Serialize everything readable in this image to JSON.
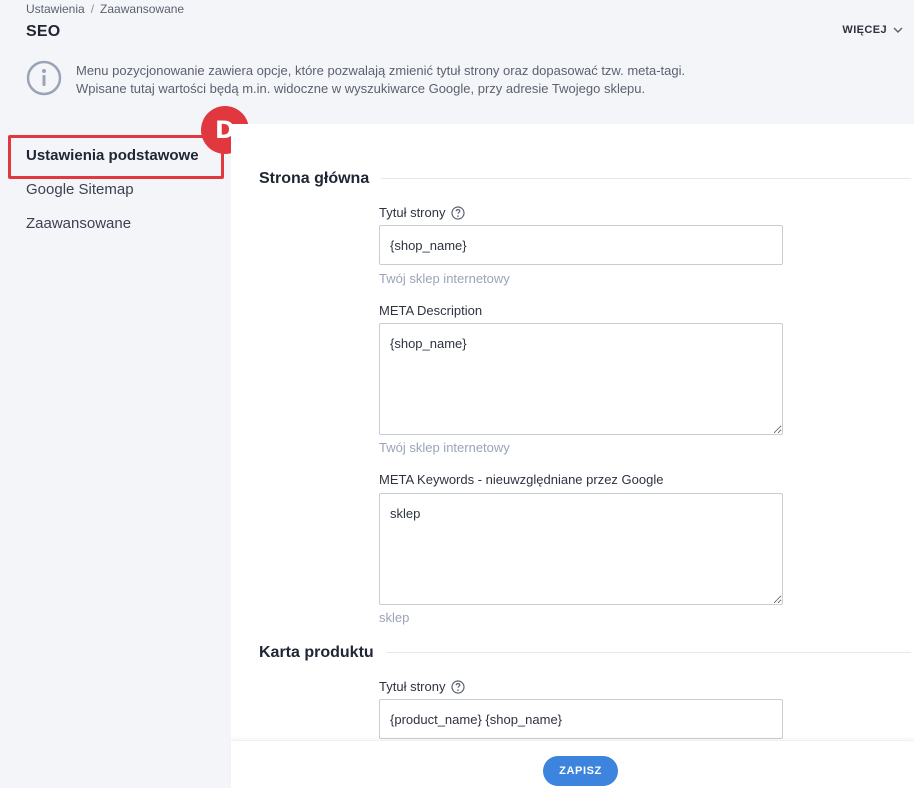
{
  "breadcrumb": {
    "items": [
      "Ustawienia",
      "Zaawansowane"
    ],
    "separator": "/"
  },
  "page_title": "SEO",
  "more_button": {
    "label": "WIĘCEJ",
    "icon": "chevron-down-icon"
  },
  "info": {
    "icon": "info-icon",
    "line1": "Menu pozycjonowanie zawiera opcje, które pozwalają zmienić tytuł strony oraz dopasować tzw. meta-tagi.",
    "line2": "Wpisane tutaj wartości będą m.in. widoczne w wyszukiwarce Google, przy adresie Twojego sklepu."
  },
  "sidebar": {
    "items": [
      {
        "label": "Ustawienia podstawowe",
        "active": true
      },
      {
        "label": "Google Sitemap",
        "active": false
      },
      {
        "label": "Zaawansowane",
        "active": false
      }
    ]
  },
  "annotation": {
    "badge": "D",
    "color": "#e0383e"
  },
  "main": {
    "home_section": {
      "title": "Strona główna",
      "page_title_field": {
        "label": "Tytuł strony",
        "value": "{shop_name}",
        "hint": "Twój sklep internetowy"
      },
      "meta_description": {
        "label": "META Description",
        "value": "{shop_name}",
        "hint": "Twój sklep internetowy"
      },
      "meta_keywords": {
        "label": "META Keywords - nieuwzględniane przez Google",
        "value": "sklep",
        "hint": "sklep"
      }
    },
    "product_section": {
      "title": "Karta produktu",
      "page_title_field": {
        "label": "Tytuł strony",
        "value": "{product_name} {shop_name}"
      }
    }
  },
  "footer": {
    "save_label": "ZAPISZ"
  },
  "colors": {
    "accent": "#3c84dd",
    "highlight": "#e0383e",
    "panel_bg": "#f4f5f8",
    "hint": "#9aa3b8"
  }
}
